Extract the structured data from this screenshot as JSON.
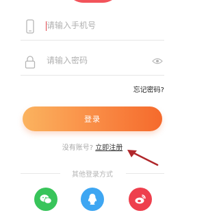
{
  "form": {
    "phone_placeholder": "请输入手机号",
    "password_placeholder": "请输入密码",
    "forgot_password": "忘记密码?"
  },
  "actions": {
    "login_label": "登录",
    "no_account_text": "没有账号?",
    "register_link": "立即注册"
  },
  "social": {
    "label": "其他登录方式",
    "providers": [
      {
        "name": "wechat",
        "icon": "wechat-icon",
        "color": "#38c45a"
      },
      {
        "name": "qq",
        "icon": "qq-icon",
        "color": "#3ea6f2"
      },
      {
        "name": "weibo",
        "icon": "weibo-icon",
        "color": "#ee3f4d"
      }
    ]
  },
  "colors": {
    "accent_start": "#fbb35f",
    "accent_end": "#f56a2c",
    "annotation_arrow": "#b0272b"
  }
}
